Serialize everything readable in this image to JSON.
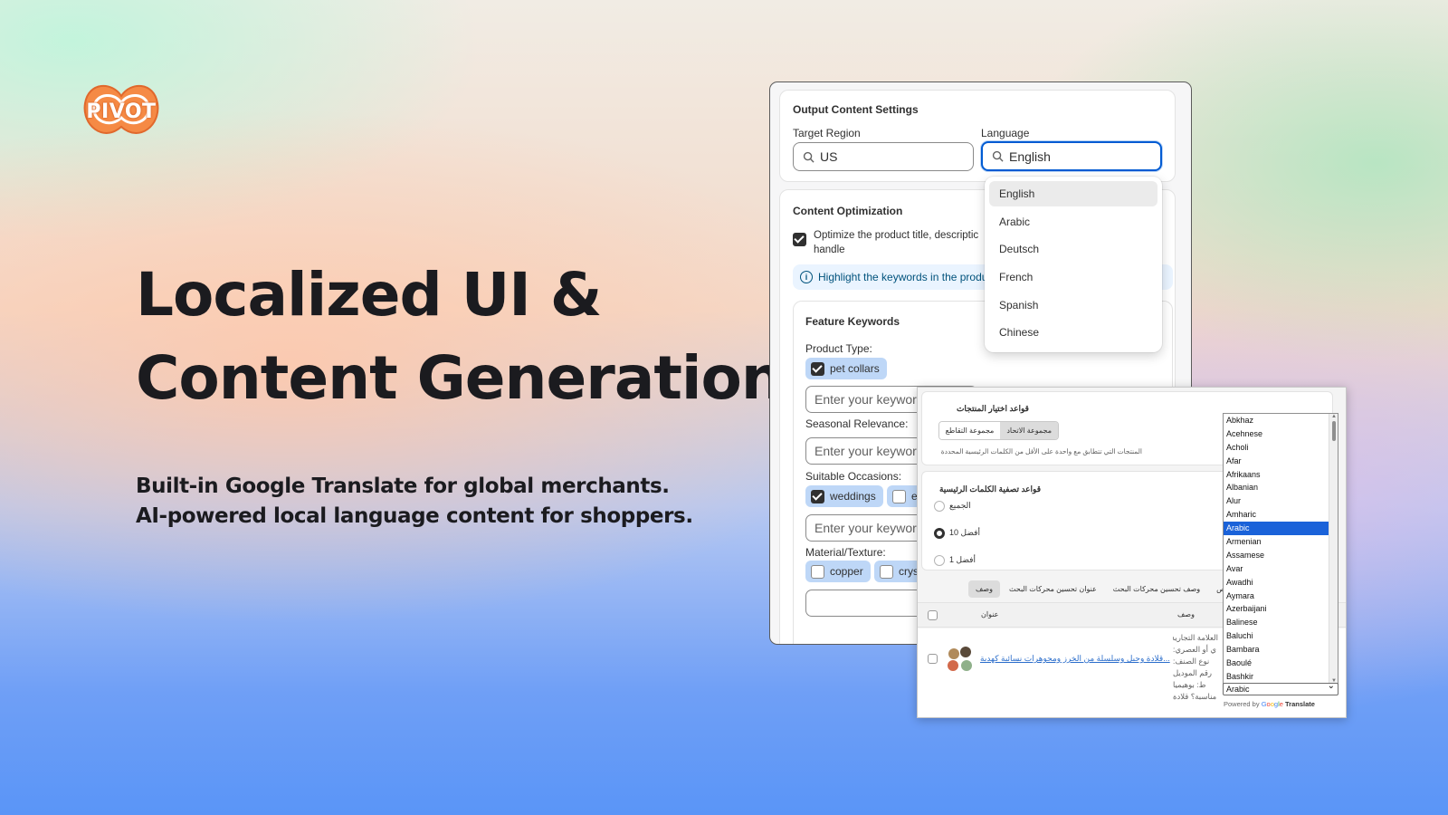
{
  "logo": {
    "text": "PIVOT"
  },
  "hero": {
    "headline_line1": "Localized UI &",
    "headline_line2": "Content Generation",
    "sub_line1": "Built-in Google Translate for global merchants.",
    "sub_line2": "AI-powered local language content for shoppers."
  },
  "settings": {
    "output_title": "Output Content Settings",
    "region_label": "Target Region",
    "region_value": "US",
    "language_label": "Language",
    "language_value": "English",
    "optimization_title": "Content Optimization",
    "optimize_text_line1": "Optimize the product title, descriptic",
    "optimize_text_line2": "handle",
    "highlight_text": "Highlight the keywords in the produ",
    "keywords_title": "Feature Keywords",
    "product_type_label": "Product Type:",
    "product_type_chip": "pet collars",
    "keyword_placeholder": "Enter your keywor",
    "seasonal_label": "Seasonal Relevance:",
    "occasions_label": "Suitable Occasions:",
    "occasion_chip_1": "weddings",
    "occasion_chip_2": "e",
    "material_label": "Material/Texture:",
    "material_chip_1": "copper",
    "material_chip_2": "crys"
  },
  "language_dropdown": {
    "options": [
      "English",
      "Arabic",
      "Deutsch",
      "French",
      "Spanish",
      "Chinese"
    ],
    "selected": "English"
  },
  "arabic_panel": {
    "selection_rules_title": "قواعد اختيار المنتجات",
    "seg_union": "مجموعة الاتحاد",
    "seg_intersection": "مجموعة التقاطع",
    "selection_hint": "المنتجات التي تتطابق مع واحدة على الأقل من الكلمات الرئيسية المحددة",
    "filter_title": "قواعد تصفية الكلمات الرئيسية",
    "radio_all": "الجميع",
    "radio_top10": "أفضل 10",
    "radio_top1": "أفضل 1",
    "tab_description": "وصف",
    "tab_seo_title": "عنوان تحسين محركات البحث",
    "tab_seo_desc": "وصف تحسين محركات البحث",
    "tab_cut": "ص",
    "col_title": "عنوان",
    "col_description": "وصف",
    "product_link": "...قلادة وحبل وسلسلة من الخرز ومجوهرات نسائية كهدية",
    "desc_lines": [
      "العلامة التجارية",
      "ي أو العصري:",
      "نوع الصنف:",
      "رقم الموديل",
      "ط: بوهيميا",
      "مناسبة؟ قلادة"
    ]
  },
  "translate_widget": {
    "languages": [
      "Abkhaz",
      "Acehnese",
      "Acholi",
      "Afar",
      "Afrikaans",
      "Albanian",
      "Alur",
      "Amharic",
      "Arabic",
      "Armenian",
      "Assamese",
      "Avar",
      "Awadhi",
      "Aymara",
      "Azerbaijani",
      "Balinese",
      "Baluchi",
      "Bambara",
      "Baoulé",
      "Bashkir"
    ],
    "selected": "Arabic",
    "powered_prefix": "Powered by",
    "powered_brand": "Translate"
  },
  "colors": {
    "focus_blue": "#005bd3",
    "chip_blue": "#bed7f7",
    "logo_orange": "#f07c3c",
    "list_select": "#1a62d9"
  }
}
